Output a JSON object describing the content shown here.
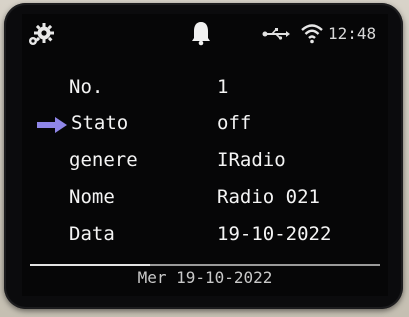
{
  "status_bar": {
    "clock": "12:48",
    "icons": [
      "settings-gear-icon",
      "bell-icon",
      "usb-icon",
      "wifi-icon"
    ]
  },
  "rows": [
    {
      "label": "No.",
      "value": "1"
    },
    {
      "label": "Stato",
      "value": "off"
    },
    {
      "label": "genere",
      "value": "IRadio"
    },
    {
      "label": "Nome",
      "value": "Radio 021"
    },
    {
      "label": "Data",
      "value": "19-10-2022"
    }
  ],
  "selected_row": "Stato",
  "footer": {
    "date_line": "Mer 19-10-2022"
  },
  "colors": {
    "selection_arrow": "#8f86e8",
    "text": "#f4f4f4",
    "background": "#060607"
  }
}
